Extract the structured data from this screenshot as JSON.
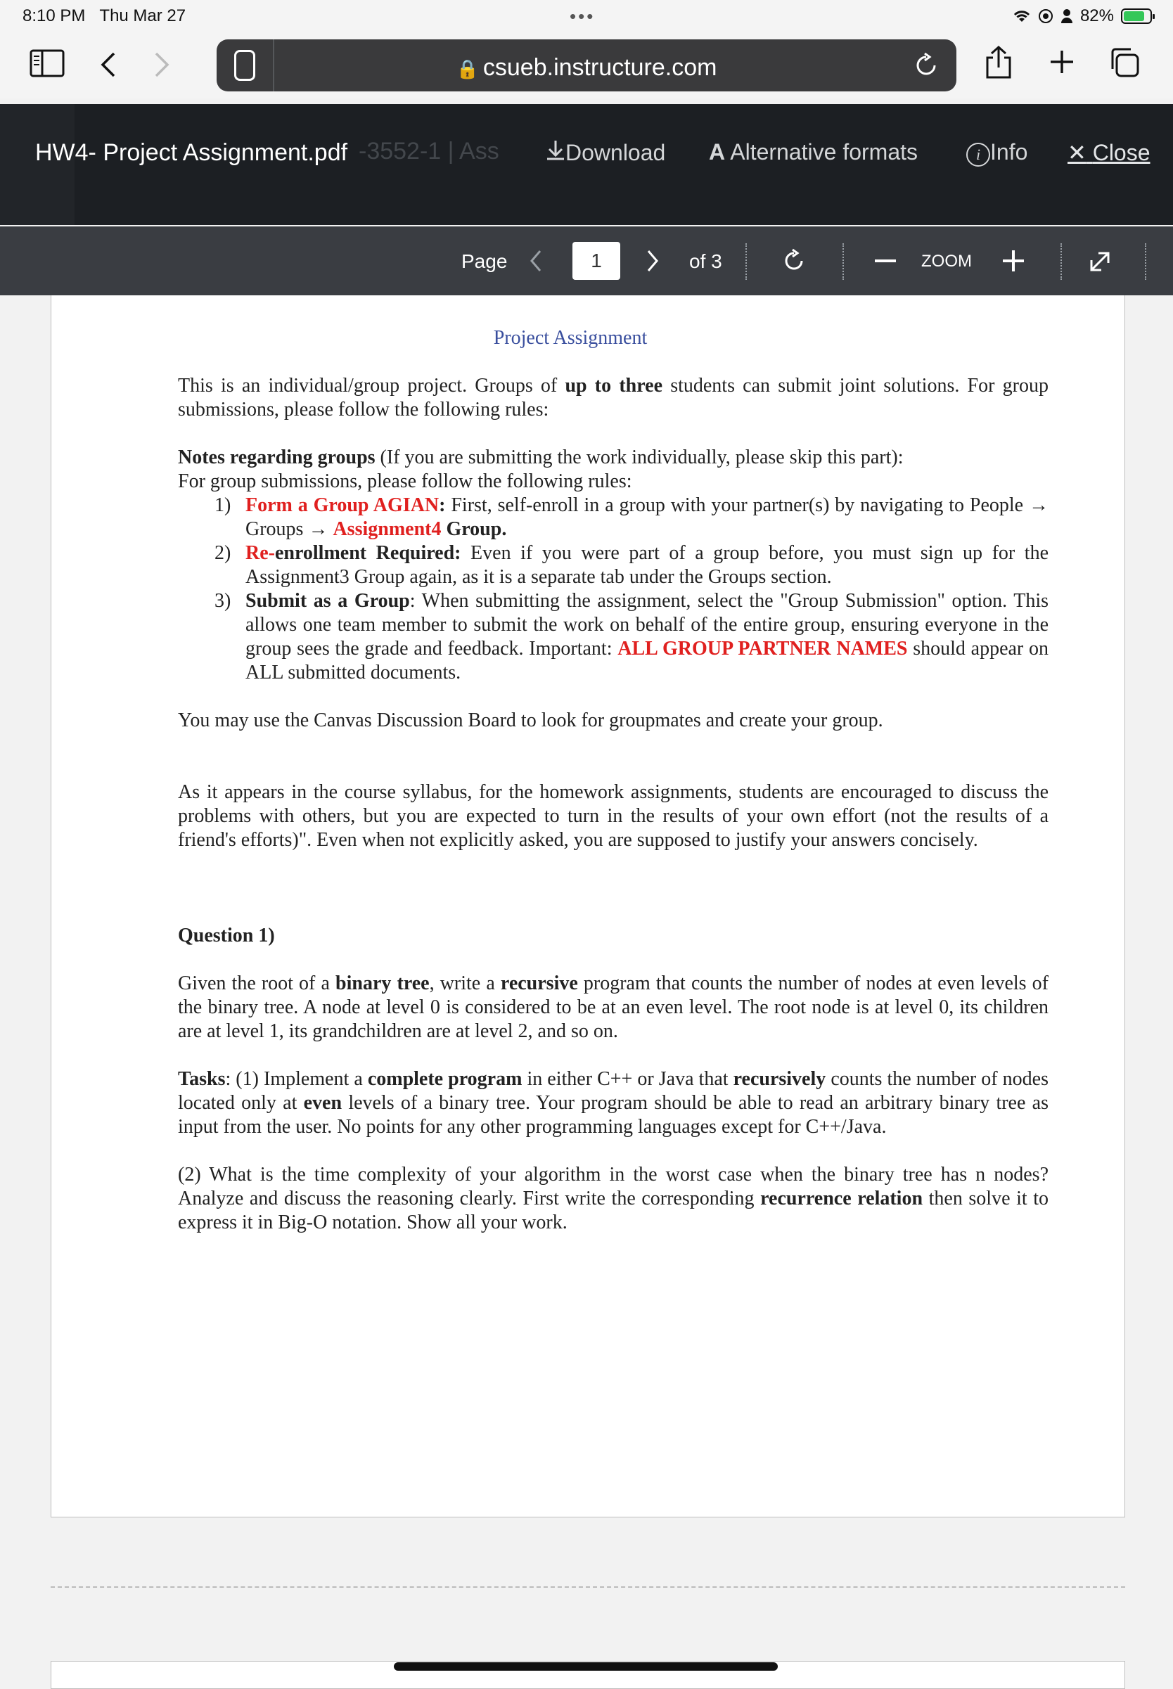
{
  "status": {
    "time": "8:10 PM",
    "date": "Thu Mar 27",
    "battery": "82%",
    "battery_level": 0.82,
    "icons": [
      "wifi-icon",
      "location-icon",
      "person-icon",
      "battery-icon"
    ]
  },
  "browser": {
    "url": "csueb.instructure.com"
  },
  "viewer": {
    "filename": "HW4- Project Assignment.pdf",
    "ghost_text": "-3552-1 | Ass",
    "download": "Download",
    "alt_formats": "Alternative formats",
    "info": "Info",
    "close": "Close"
  },
  "toolbar": {
    "page_label": "Page",
    "page": "1",
    "of_label": "of 3",
    "zoom_label": "ZOOM"
  },
  "doc": {
    "title": "Project Assignment",
    "intro_1": "This is an individual/group project. Groups of ",
    "intro_bold": "up to three",
    "intro_2": " students can submit joint solutions. For group submissions, please follow the following rules:",
    "notes_bold": "Notes regarding groups",
    "notes_rest": " (If you are submitting the work individually, please skip this part):",
    "notes_line2": "For group submissions, please follow the following rules:",
    "r1_num": "1)",
    "r1_red": "Form a Group AGIAN",
    "r1_colon": ":",
    "r1_text": " First, self-enroll in a group with your partner(s) by navigating to People → Groups → ",
    "r1_red2": "Assignment4",
    "r1_end": " Group.",
    "r2_num": "2)",
    "r2_red": "Re-",
    "r2_bold": "enrollment Required:",
    "r2_text": " Even if you were part of a group before, you must sign up for the Assignment3 Group again, as it is a separate tab under the Groups section.",
    "r3_num": "3)",
    "r3_bold": "Submit as a Group",
    "r3_text": ": When submitting the assignment, select the \"Group Submission\" option. This allows one team member to submit the work on behalf of the entire group, ensuring everyone in the group sees the grade and feedback. Important: ",
    "r3_red": "ALL GROUP PARTNER NAMES",
    "r3_end": " should appear on ALL submitted documents.",
    "discussion": "You may use the Canvas Discussion Board to look for groupmates and create your group.",
    "syllabus": "As it appears in the course syllabus, for the homework assignments, students are encouraged to discuss the problems with others, but you are expected to turn in the results of your own effort (not the results of a friend's efforts)\". Even when not explicitly asked, you are supposed to justify your answers concisely.",
    "q1_heading": "Question 1)",
    "q1_a": "Given the root of a ",
    "q1_b": "binary tree",
    "q1_c": ", write a ",
    "q1_d": "recursive",
    "q1_e": " program that counts the number of nodes at even levels of the binary tree. A node at level 0 is considered to be at an even level. The root node is at level 0, its children are at level 1, its grandchildren are at level 2, and so on.",
    "t_a": "Tasks",
    "t_b": ": (1) Implement a ",
    "t_c": "complete program",
    "t_d": " in either C++ or Java that ",
    "t_e": "recursively",
    "t_f": " counts the number of nodes located only at ",
    "t_g": "even",
    "t_h": " levels of a binary tree. Your program should be able to read an arbitrary binary tree as input from the user. No points for any other programming languages except for C++/Java.",
    "p2_a": "(2) What is the time complexity of your algorithm in the worst case when the binary tree has n nodes? Analyze and discuss the reasoning clearly. First write the corresponding ",
    "p2_b": "recurrence relation",
    "p2_c": " then solve it to express it in Big-O notation. Show all your work."
  }
}
